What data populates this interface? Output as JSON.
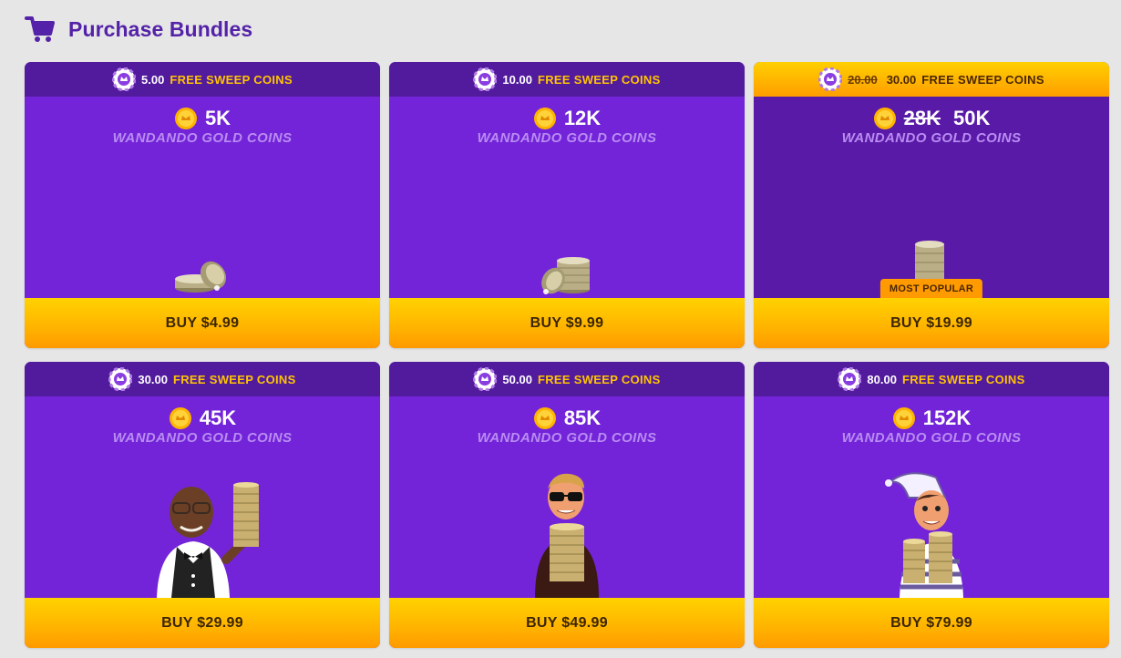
{
  "header": {
    "title": "Purchase Bundles",
    "icon": "cart-icon"
  },
  "colors": {
    "accent": "#5422a8",
    "card": "#7324d8",
    "strip": "#521b9e",
    "gold": "#ffc400"
  },
  "bundles": [
    {
      "sweep_old": "",
      "sweep_amount": "5.00",
      "sweep_label": "FREE SWEEP COINS",
      "gold_old": "",
      "gold_amount": "5K",
      "gold_label": "WANDANDO GOLD COINS",
      "buy_label": "BUY $4.99",
      "badge": "",
      "art": "coin-stack-small"
    },
    {
      "sweep_old": "",
      "sweep_amount": "10.00",
      "sweep_label": "FREE SWEEP COINS",
      "gold_old": "",
      "gold_amount": "12K",
      "gold_label": "WANDANDO GOLD COINS",
      "buy_label": "BUY $9.99",
      "badge": "",
      "art": "coin-stack-medium"
    },
    {
      "sweep_old": "20.00",
      "sweep_amount": "30.00",
      "sweep_label": "FREE SWEEP COINS",
      "gold_old": "28K",
      "gold_amount": "50K",
      "gold_label": "WANDANDO GOLD COINS",
      "buy_label": "BUY $19.99",
      "badge": "MOST POPULAR",
      "art": "coin-stack-tall"
    },
    {
      "sweep_old": "",
      "sweep_amount": "30.00",
      "sweep_label": "FREE SWEEP COINS",
      "gold_old": "",
      "gold_amount": "45K",
      "gold_label": "WANDANDO GOLD COINS",
      "buy_label": "BUY $29.99",
      "badge": "",
      "art": "butler-character"
    },
    {
      "sweep_old": "",
      "sweep_amount": "50.00",
      "sweep_label": "FREE SWEEP COINS",
      "gold_old": "",
      "gold_amount": "85K",
      "gold_label": "WANDANDO GOLD COINS",
      "buy_label": "BUY $49.99",
      "badge": "",
      "art": "sunglasses-character"
    },
    {
      "sweep_old": "",
      "sweep_amount": "80.00",
      "sweep_label": "FREE SWEEP COINS",
      "gold_old": "",
      "gold_amount": "152K",
      "gold_label": "WANDANDO GOLD COINS",
      "buy_label": "BUY $79.99",
      "badge": "",
      "art": "jester-character"
    }
  ]
}
